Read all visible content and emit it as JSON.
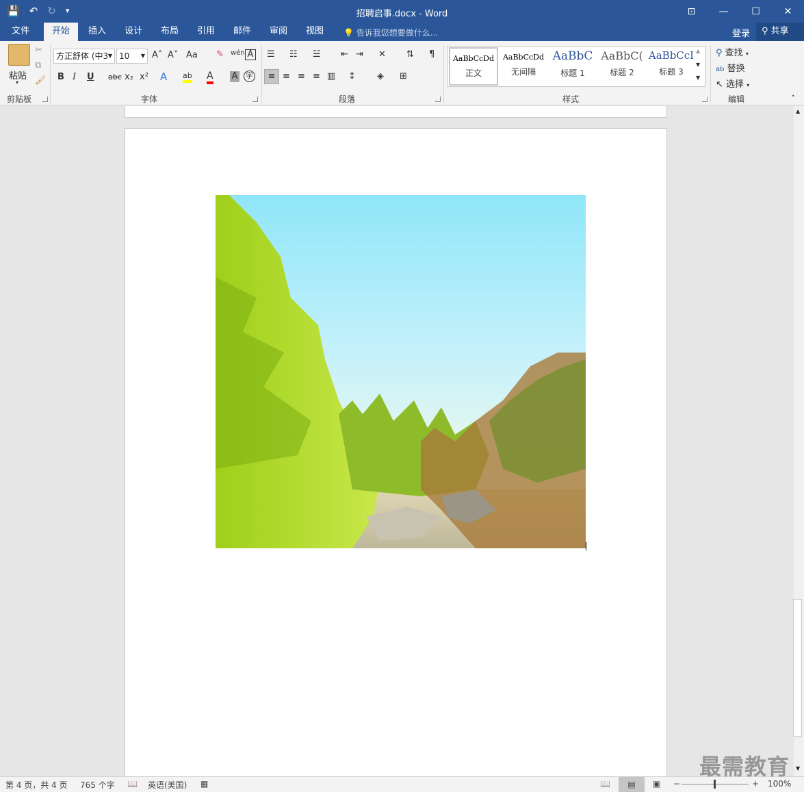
{
  "window": {
    "title": "招聘启事.docx - Word"
  },
  "qat": {
    "save_icon": "💾",
    "undo_icon": "↶",
    "redo_icon": "↻",
    "customize_icon": "▾"
  },
  "win_controls": {
    "ribbon_display": "⊡",
    "minimize": "—",
    "maximize": "☐",
    "close": "✕"
  },
  "tabs": [
    {
      "label": "文件"
    },
    {
      "label": "开始"
    },
    {
      "label": "插入"
    },
    {
      "label": "设计"
    },
    {
      "label": "布局"
    },
    {
      "label": "引用"
    },
    {
      "label": "邮件"
    },
    {
      "label": "审阅"
    },
    {
      "label": "视图"
    }
  ],
  "tell_me": "告诉我您想要做什么...",
  "account": {
    "login": "登录",
    "share": "共享"
  },
  "clipboard": {
    "paste": "粘贴",
    "label": "剪贴板"
  },
  "font": {
    "name": "方正舒体 (中3",
    "size": "10",
    "label": "字体",
    "bold": "B",
    "italic": "I",
    "underline": "U",
    "strike": "abc",
    "sub": "x₂",
    "sup": "x²",
    "grow": "A˄",
    "shrink": "A˅",
    "case": "Aa",
    "text_effect": "A",
    "highlight": "ab",
    "font_color": "A",
    "char_shading": "A",
    "enclose": "字",
    "phonetic": "wén",
    "border": "A"
  },
  "paragraph": {
    "label": "段落"
  },
  "styles": {
    "label": "样式",
    "items": [
      {
        "preview": "AaBbCcDd",
        "name": "正文"
      },
      {
        "preview": "AaBbCcDd",
        "name": "无间隔"
      },
      {
        "preview": "AaBbC",
        "name": "标题 1"
      },
      {
        "preview": "AaBbC(",
        "name": "标题 2"
      },
      {
        "preview": "AaBbCcI",
        "name": "标题 3"
      }
    ]
  },
  "editing": {
    "find": "查找",
    "replace": "替换",
    "select": "选择",
    "label": "编辑"
  },
  "status": {
    "page": "第 4 页，共 4 页",
    "words": "765 个字",
    "language": "英语(美国)",
    "zoom": "100%"
  },
  "watermark": "最需教育",
  "colors": {
    "brand": "#2b579a",
    "highlight": "#ffff00",
    "font_red": "#ff0000"
  }
}
